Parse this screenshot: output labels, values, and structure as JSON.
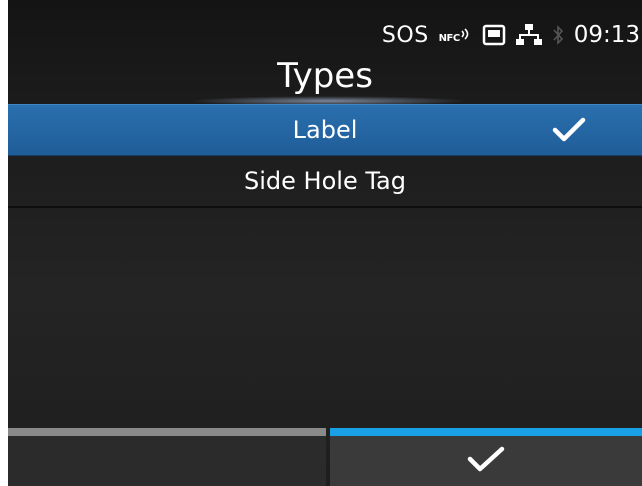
{
  "status_bar": {
    "sos_label": "SOS",
    "nfc_label": "NFC",
    "time": "09:13",
    "icons": [
      "nfc-icon",
      "sd-card-icon",
      "network-icon",
      "bluetooth-icon"
    ]
  },
  "header": {
    "title": "Types"
  },
  "list": {
    "items": [
      {
        "label": "Label",
        "selected": true
      },
      {
        "label": "Side Hole Tag",
        "selected": false
      }
    ]
  },
  "softkeys": {
    "left": {
      "label": "",
      "accent": "#8a8a8a"
    },
    "right": {
      "icon": "check-icon",
      "accent": "#1aa0e6"
    }
  },
  "colors": {
    "selection": "#2266a3",
    "background": "#1e1e1e",
    "accent_blue": "#1aa0e6"
  }
}
